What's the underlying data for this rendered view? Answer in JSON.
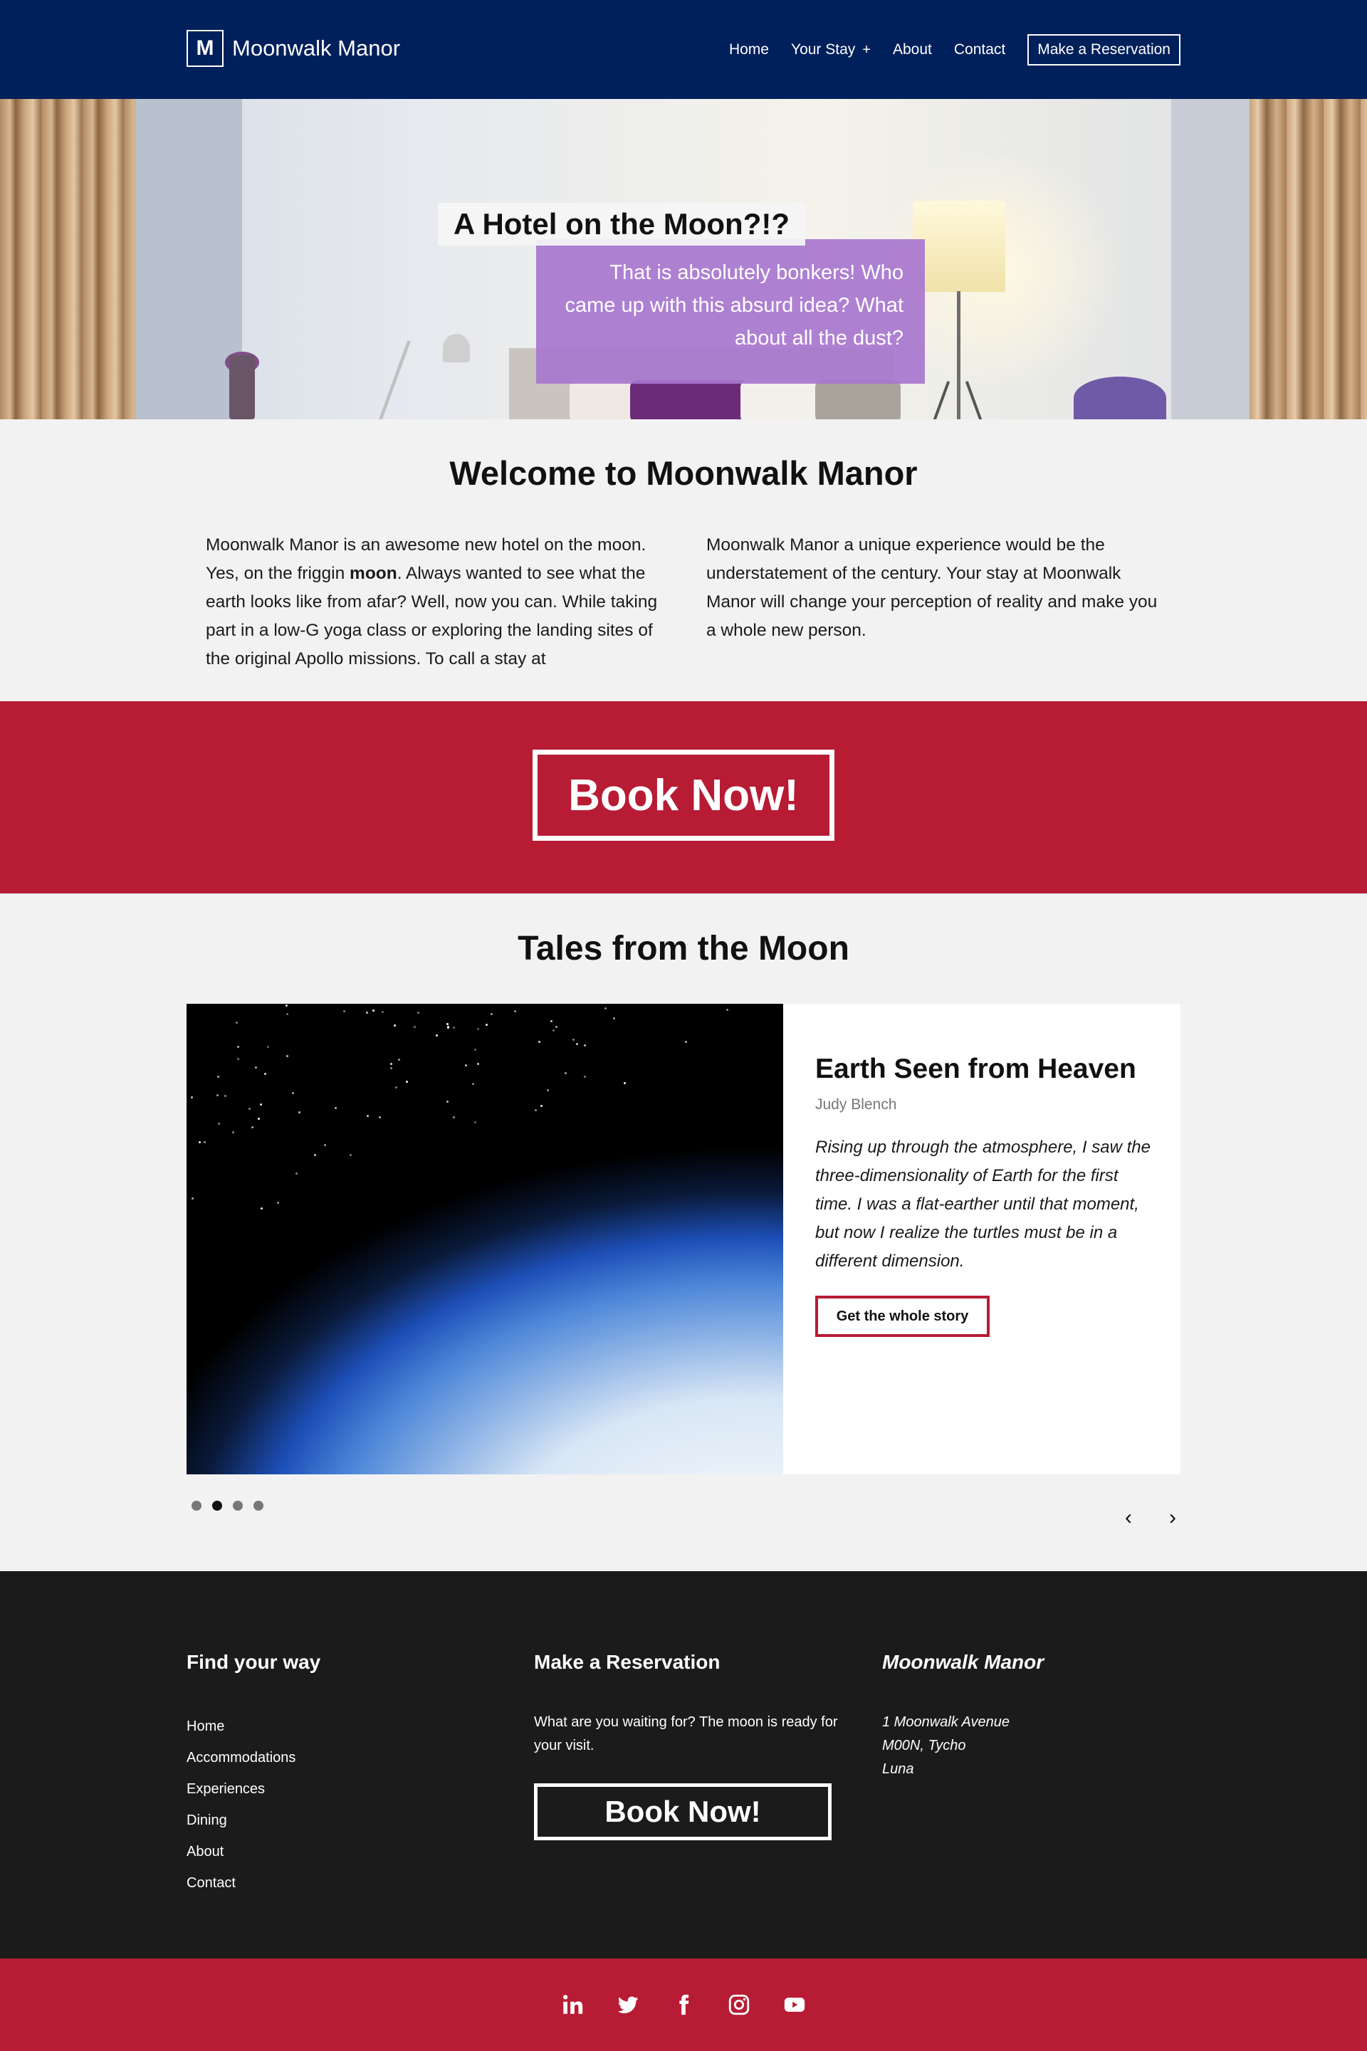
{
  "header": {
    "logo_letter": "M",
    "logo_text": "Moonwalk Manor",
    "nav": [
      {
        "label": "Home"
      },
      {
        "label": "Your Stay",
        "plus": "+"
      },
      {
        "label": "About"
      },
      {
        "label": "Contact"
      }
    ],
    "cta_label": "Make a Reservation"
  },
  "hero": {
    "title": "A Hotel on the Moon?!?",
    "subtitle": "That is absolutely bonkers! Who came up with this absurd idea? What about all the dust?"
  },
  "welcome": {
    "title": "Welcome to Moonwalk Manor",
    "col1_before": "Moonwalk Manor is an awesome new hotel on the moon. Yes, on the friggin ",
    "col1_bold": "moon",
    "col1_after": ". Always wanted to see what the earth looks like from afar? Well, now you can. While taking part in a low-G yoga class or exploring the landing sites of the original Apollo missions. To call a stay at",
    "col2": "Moonwalk Manor a unique experience would be the understatement of the century. Your stay at Moonwalk Manor will change your perception of reality and make you a whole new person."
  },
  "book_band": {
    "label": "Book Now!"
  },
  "tales": {
    "title": "Tales from the Moon",
    "story": {
      "title": "Earth Seen from Heaven",
      "author": "Judy Blench",
      "text": "Rising up through the atmosphere, I saw the three-dimensionality of Earth for the first time. I was a flat-earther until that moment, but now I realize the turtles must be in a different dimension.",
      "button": "Get the whole story"
    },
    "slides": 4,
    "active_slide": 2,
    "prev": "‹",
    "next": "›"
  },
  "footer": {
    "col1": {
      "heading": "Find your way",
      "links": [
        "Home",
        "Accommodations",
        "Experiences",
        "Dining",
        "About",
        "Contact"
      ]
    },
    "col2": {
      "heading": "Make a Reservation",
      "text": "What are you waiting for? The moon is ready for your visit.",
      "button": "Book Now!"
    },
    "col3": {
      "heading": "Moonwalk Manor",
      "address": [
        "1 Moonwalk Avenue",
        "M00N, Tycho",
        "Luna"
      ]
    }
  },
  "social": [
    "linkedin-icon",
    "twitter-icon",
    "facebook-icon",
    "instagram-icon",
    "youtube-icon"
  ],
  "colors": {
    "header_bg": "#00205b",
    "accent_red": "#b71c34",
    "hero_purple": "#a876ce",
    "footer_bg": "#1b1b1b",
    "page_bg": "#f2f2f2"
  }
}
